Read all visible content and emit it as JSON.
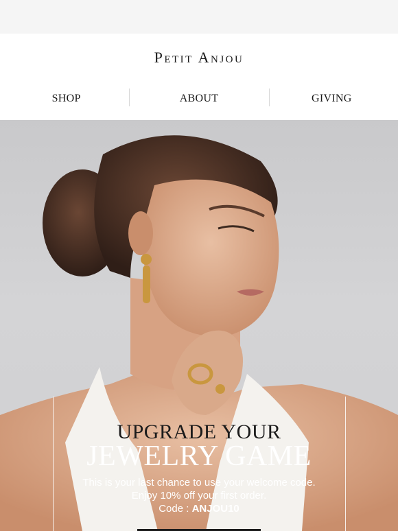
{
  "brand": {
    "name": "Petit Anjou"
  },
  "nav": {
    "items": [
      {
        "label": "SHOP"
      },
      {
        "label": "ABOUT"
      },
      {
        "label": "GIVING"
      }
    ]
  },
  "hero": {
    "headline_line1": "UPGRADE YOUR",
    "headline_line2": "JEWELRY GAME",
    "body": "This is your last chance to use your welcome code. Enjoy 10% off your first order.",
    "code_label": "Code :",
    "code_value": "ANJOU10"
  },
  "colors": {
    "text": "#1a1a1a",
    "hero_bg": "#cfcfd1",
    "skin": "#d9a98a",
    "gold": "#c9973f",
    "hair": "#4a3226"
  }
}
